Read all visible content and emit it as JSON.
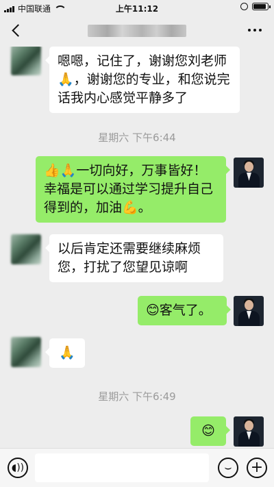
{
  "status_bar": {
    "carrier": "中国联通",
    "time": "上午11:12"
  },
  "nav": {
    "back_icon": "chevron-left-icon",
    "more_icon": "more-icon"
  },
  "messages": [
    {
      "side": "left",
      "text": "嗯嗯，记住了，谢谢您刘老师🙏，谢谢您的专业，和您说完话我内心感觉平静多了"
    },
    {
      "type": "time",
      "text": "星期六 下午6:44"
    },
    {
      "side": "right",
      "text": "👍🙏一切向好，万事皆好！幸福是可以通过学习提升自己得到的，加油💪。"
    },
    {
      "side": "left",
      "text": "以后肯定还需要继续麻烦您，打扰了您望见谅啊"
    },
    {
      "side": "right",
      "text": "😊客气了。"
    },
    {
      "side": "left",
      "text": "🙏"
    },
    {
      "type": "time",
      "text": "星期六 下午6:49"
    },
    {
      "side": "right",
      "text": "😊"
    }
  ],
  "toolbar": {
    "voice_icon": "voice-icon",
    "emoji_icon": "emoji-icon",
    "plus_icon": "plus-icon"
  }
}
